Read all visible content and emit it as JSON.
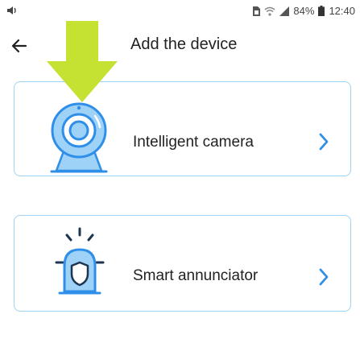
{
  "status_bar": {
    "battery": "84%",
    "time": "12:40",
    "icons": [
      "volume-icon",
      "sim-card-icon",
      "wifi-icon",
      "signal-icon",
      "battery-icon"
    ]
  },
  "header": {
    "title": "Add the device",
    "back_icon": "arrow-left-icon"
  },
  "devices": [
    {
      "label": "Intelligent camera",
      "icon": "camera-icon"
    },
    {
      "label": "Smart annunciator",
      "icon": "alarm-siren-icon"
    }
  ],
  "colors": {
    "accent": "#2f8fe8",
    "icon_fill": "#9ed2f6",
    "card_border": "#9fd2f3",
    "pointer": "#c5e132"
  }
}
